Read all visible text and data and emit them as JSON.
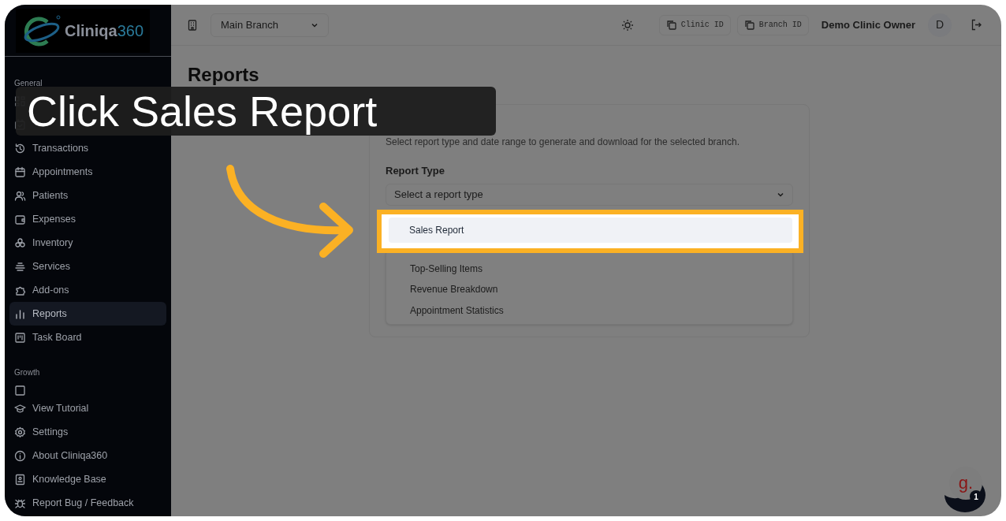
{
  "logo": {
    "name": "Cliniqa",
    "suffix": "360"
  },
  "header": {
    "branch_select": "Main Branch",
    "copy_buttons": [
      {
        "label": "Clinic ID"
      },
      {
        "label": "Branch ID"
      }
    ],
    "user_name": "Demo Clinic Owner",
    "avatar": "D"
  },
  "page_title": "Reports",
  "sidebar": {
    "sections": [
      {
        "title": "General",
        "items": [
          {
            "selected": false
          },
          {
            "selected": false
          },
          {
            "label": "Transactions",
            "selected": false
          },
          {
            "label": "Appointments",
            "selected": false
          },
          {
            "label": "Patients",
            "selected": false
          },
          {
            "label": "Expenses",
            "selected": false
          },
          {
            "label": "Inventory",
            "selected": false
          },
          {
            "label": "Services",
            "selected": false
          },
          {
            "label": "Add-ons",
            "selected": false
          },
          {
            "label": "Reports",
            "selected": true
          },
          {
            "label": "Task Board",
            "selected": false
          }
        ]
      },
      {
        "title": "Growth",
        "items": [
          {
            "selected": false
          }
        ]
      }
    ],
    "footer_items": [
      {
        "label": "View Tutorial"
      },
      {
        "label": "Settings"
      },
      {
        "label": "About Cliniqa360"
      },
      {
        "label": "Knowledge Base"
      },
      {
        "label": "Report Bug / Feedback"
      }
    ]
  },
  "card": {
    "subtitle": "Select report type and date range to generate and download for the selected branch.",
    "field_label": "Report Type",
    "select_placeholder": "Select a report type",
    "options": [
      {
        "label": "Sales Report",
        "selected": true
      },
      {
        "label": "Top-Selling Items",
        "selected": false
      },
      {
        "label": "Revenue Breakdown",
        "selected": false
      },
      {
        "label": "Appointment Statistics",
        "selected": false
      }
    ]
  },
  "tutorial": {
    "caption": "Click Sales Report"
  },
  "chat_widget": {
    "logo": "g.",
    "badge": "1"
  }
}
